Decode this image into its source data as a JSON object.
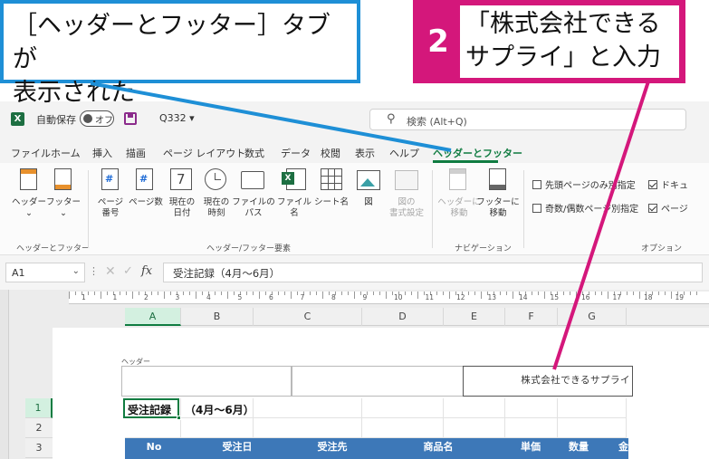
{
  "callouts": {
    "step1_text_line1": "［ヘッダーとフッター］タブが",
    "step1_text_line2": "表示された",
    "step2_number": "2",
    "step2_text_line1": "「株式会社できる",
    "step2_text_line2": "サプライ」と入力",
    "step1_border_color": "#1e8fd6",
    "step2_color": "#d4177b"
  },
  "titlebar": {
    "app_icon": "excel-icon",
    "autosave_label": "自動保存",
    "autosave_state": "オフ",
    "save_icon": "save-icon",
    "filename": "Q332",
    "filename_chevron": "▾",
    "search_placeholder": "検索 (Alt+Q)"
  },
  "menu": {
    "items": [
      "ファイル",
      "ホーム",
      "挿入",
      "描画",
      "ページ レイアウト",
      "数式",
      "データ",
      "校閲",
      "表示",
      "ヘルプ",
      "ヘッダーとフッター"
    ],
    "active_index": 10,
    "active_color": "#107c41"
  },
  "ribbon": {
    "header_label": "ヘッダー",
    "footer_label": "フッター",
    "dropdown_chevron": "⌄",
    "group1_label": "ヘッダーとフッター",
    "page_number": "ページ\n番号",
    "page_count": "ページ数",
    "current_date": "現在の\n日付",
    "current_time": "現在の\n時刻",
    "file_path": "ファイルの\nパス",
    "file_name": "ファイル名",
    "sheet_name": "シート名",
    "picture": "図",
    "format_picture": "図の\n書式設定",
    "group2_label": "ヘッダー/フッター要素",
    "goto_header": "ヘッダーに\n移動",
    "goto_footer": "フッターに\n移動",
    "group3_label": "ナビゲーション",
    "opt_first_page": "先頭ページのみ別指定",
    "opt_odd_even": "奇数/偶数ページ別指定",
    "opt_scale": "ドキュ",
    "opt_align": "ページ",
    "group4_label": "オプション"
  },
  "formula_bar": {
    "name_box": "A1",
    "name_chevron": "⌄",
    "dots": "⋮",
    "cancel": "✕",
    "enter": "✓",
    "fx": "fx",
    "formula": "受注記録（4月～6月）"
  },
  "sheet": {
    "ruler_numbers": [
      "1",
      "1",
      "2",
      "3",
      "4",
      "5",
      "6",
      "7",
      "8",
      "9",
      "10",
      "11",
      "12",
      "13",
      "14",
      "15",
      "16",
      "17",
      "18",
      "19"
    ],
    "columns": [
      "A",
      "B",
      "C",
      "D",
      "E",
      "F",
      "G"
    ],
    "rows": [
      "1",
      "2",
      "3"
    ],
    "header_area_label": "ヘッダー",
    "header_right_text": "株式会社できるサプライ",
    "cell_a1": "受注記録",
    "cell_b1": "（4月～6月）",
    "table_headers": [
      "No",
      "受注日",
      "受注先",
      "商品名",
      "単価",
      "数量",
      "金額"
    ],
    "table_header_color": "#3d78b8"
  }
}
